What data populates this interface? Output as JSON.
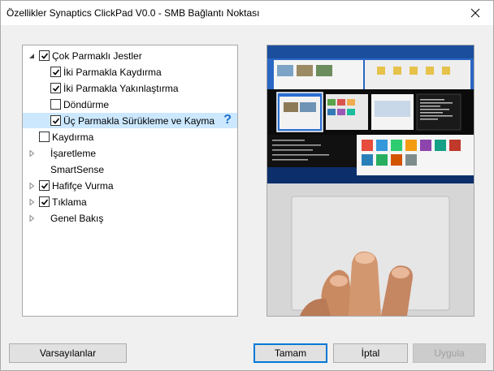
{
  "window": {
    "title": "Özellikler Synaptics ClickPad V0.0 - SMB Bağlantı Noktası"
  },
  "tree": {
    "items": [
      {
        "label": "Çok Parmaklı Jestler",
        "checkbox": true,
        "checked": true,
        "expander": "expanded",
        "level": 0
      },
      {
        "label": "İki Parmakla Kaydırma",
        "checkbox": true,
        "checked": true,
        "expander": "none",
        "level": 1
      },
      {
        "label": "İki Parmakla Yakınlaştırma",
        "checkbox": true,
        "checked": true,
        "expander": "none",
        "level": 1
      },
      {
        "label": "Döndürme",
        "checkbox": true,
        "checked": false,
        "expander": "none",
        "level": 1
      },
      {
        "label": "Üç Parmakla Sürükleme ve Kayma",
        "checkbox": true,
        "checked": true,
        "expander": "none",
        "level": 1,
        "selected": true,
        "help": "?"
      },
      {
        "label": "Kaydırma",
        "checkbox": true,
        "checked": false,
        "expander": "none",
        "level": 0
      },
      {
        "label": "İşaretleme",
        "checkbox": false,
        "checked": false,
        "expander": "collapsed",
        "level": 0
      },
      {
        "label": "SmartSense",
        "checkbox": false,
        "checked": false,
        "expander": "none",
        "level": 0
      },
      {
        "label": "Hafifçe Vurma",
        "checkbox": true,
        "checked": true,
        "expander": "collapsed",
        "level": 0
      },
      {
        "label": "Tıklama",
        "checkbox": true,
        "checked": true,
        "expander": "collapsed",
        "level": 0
      },
      {
        "label": "Genel Bakış",
        "checkbox": false,
        "checked": false,
        "expander": "collapsed",
        "level": 0
      }
    ]
  },
  "buttons": {
    "defaults": "Varsayılanlar",
    "ok": "Tamam",
    "cancel": "İptal",
    "apply": "Uygula"
  },
  "colors": {
    "selection": "#cce8ff",
    "help": "#1f6fc9",
    "default_button_border": "#0078d7"
  }
}
